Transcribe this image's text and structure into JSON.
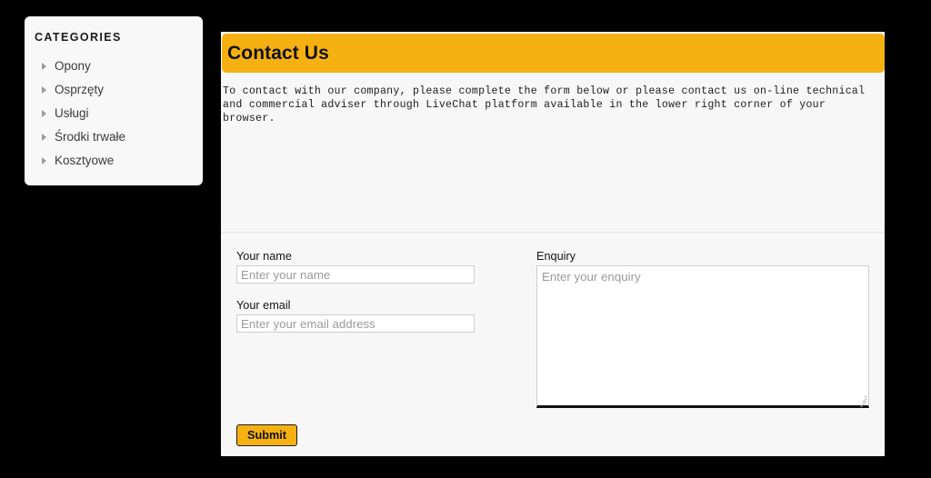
{
  "sidebar": {
    "title": "CATEGORIES",
    "items": [
      {
        "label": "Opony"
      },
      {
        "label": "Osprzęty"
      },
      {
        "label": "Usługi"
      },
      {
        "label": "Środki trwałe"
      },
      {
        "label": "Kosztyowe"
      }
    ]
  },
  "content": {
    "title": "Contact Us",
    "intro": "To contact with our company, please complete the form below or please contact us on-line technical and commercial adviser through LiveChat platform available in the lower right corner of your browser."
  },
  "form": {
    "name": {
      "label": "Your name",
      "placeholder": "Enter your name",
      "value": ""
    },
    "email": {
      "label": "Your email",
      "placeholder": "Enter your email address",
      "value": ""
    },
    "enquiry": {
      "label": "Enquiry",
      "placeholder": "Enter your enquiry",
      "value": ""
    },
    "submit_label": "Submit"
  },
  "colors": {
    "accent": "#f5b012",
    "page_background": "#000000",
    "panel_background": "#f7f7f7",
    "card_background": "#f8f8f8",
    "placeholder_text": "#9b9b9b"
  }
}
